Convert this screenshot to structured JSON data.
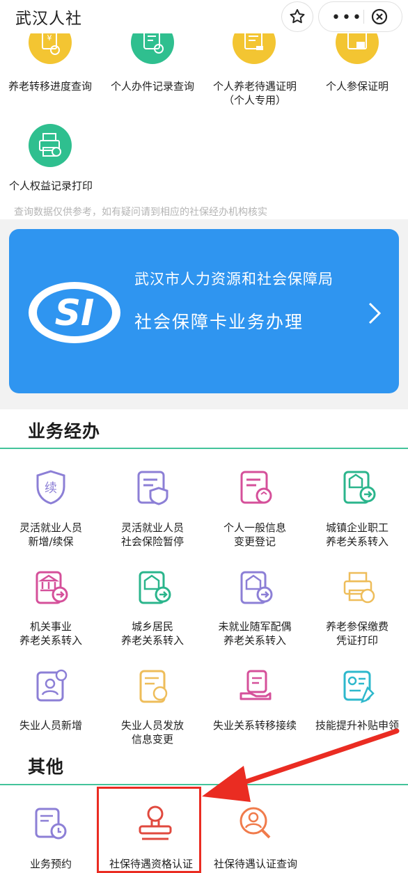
{
  "header": {
    "title": "武汉人社"
  },
  "top_grid": [
    {
      "label_lines": [
        "养老转移进度查询"
      ],
      "icon": "yen-search-icon",
      "color": "#f3c532"
    },
    {
      "label_lines": [
        "个人办件记录查询"
      ],
      "icon": "document-check-icon",
      "color": "#2fbf8f"
    },
    {
      "label_lines": [
        "个人养老待遇证明",
        "（个人专用）"
      ],
      "icon": "certificate-stamp-icon",
      "color": "#f3c532"
    },
    {
      "label_lines": [
        "个人参保证明"
      ],
      "icon": "insurance-certificate-icon",
      "color": "#f3c532"
    },
    {
      "label_lines": [
        "个人权益记录打印"
      ],
      "icon": "printer-icon",
      "color": "#2fbf8f"
    }
  ],
  "notice": "查询数据仅供参考，如有疑问请到相应的社保经办机构核实",
  "banner": {
    "logo_text": "SI",
    "org": "武汉市人力资源和社会保障局",
    "title": "社会保障卡业务办理",
    "bg_color": "#2f95f0"
  },
  "sections": {
    "business": {
      "title": "业务经办",
      "items": [
        {
          "label_lines": [
            "灵活就业人员",
            "新增/续保"
          ],
          "icon": "renew-shield-icon",
          "color": "#8c7fd6"
        },
        {
          "label_lines": [
            "灵活就业人员",
            "社会保险暂停"
          ],
          "icon": "pause-shield-icon",
          "color": "#8c7fd6"
        },
        {
          "label_lines": [
            "个人一般信息",
            "变更登记"
          ],
          "icon": "info-refresh-icon",
          "color": "#d5509a"
        },
        {
          "label_lines": [
            "城镇企业职工",
            "养老关系转入"
          ],
          "icon": "pension-transfer-icon",
          "color": "#2bb58c"
        },
        {
          "label_lines": [
            "机关事业",
            "养老关系转入"
          ],
          "icon": "institution-transfer-icon",
          "color": "#d5509a"
        },
        {
          "label_lines": [
            "城乡居民",
            "养老关系转入"
          ],
          "icon": "resident-transfer-icon",
          "color": "#2bb58c"
        },
        {
          "label_lines": [
            "未就业随军配偶",
            "养老关系转入"
          ],
          "icon": "spouse-transfer-icon",
          "color": "#8c7fd6"
        },
        {
          "label_lines": [
            "养老参保缴费",
            "凭证打印"
          ],
          "icon": "voucher-print-icon",
          "color": "#eebd5a"
        },
        {
          "label_lines": [
            "失业人员新增"
          ],
          "icon": "unemployed-add-icon",
          "color": "#8c7fd6"
        },
        {
          "label_lines": [
            "失业人员发放",
            "信息变更"
          ],
          "icon": "unemployment-change-icon",
          "color": "#eebd5a"
        },
        {
          "label_lines": [
            "失业关系转移接续"
          ],
          "icon": "hand-document-icon",
          "color": "#d5509a"
        },
        {
          "label_lines": [
            "技能提升补贴申领"
          ],
          "icon": "skill-certificate-icon",
          "color": "#2eb8cc"
        }
      ]
    },
    "other": {
      "title": "其他",
      "items": [
        {
          "label_lines": [
            "业务预约"
          ],
          "icon": "appointment-clock-icon",
          "color": "#8c7fd6"
        },
        {
          "label_lines": [
            "社保待遇资格认证"
          ],
          "icon": "stamp-icon",
          "color": "#e0493e"
        },
        {
          "label_lines": [
            "社保待遇认证查询"
          ],
          "icon": "person-search-icon",
          "color": "#f07b4b"
        }
      ]
    }
  },
  "annotation": {
    "color": "#ea2c22"
  }
}
